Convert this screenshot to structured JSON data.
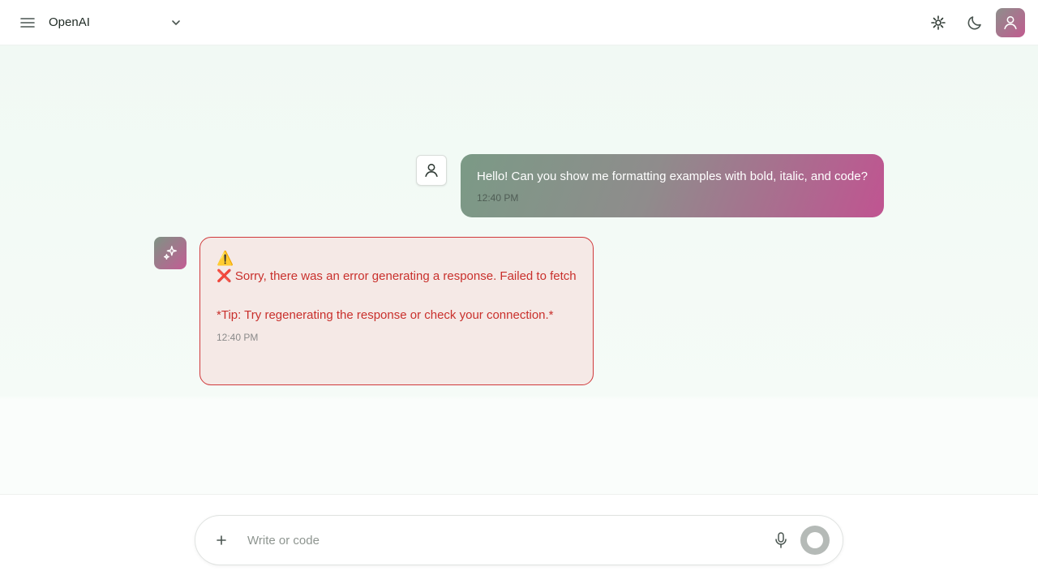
{
  "header": {
    "model_name": "OpenAI",
    "icons": {
      "menu": "hamburger-icon",
      "model_dropdown": "chevron-down-icon",
      "theme_light": "sun-icon",
      "theme_dark": "moon-icon",
      "profile": "user-icon"
    }
  },
  "messages": [
    {
      "role": "user",
      "text": "Hello! Can you show me formatting examples with bold, italic, and code?",
      "time": "12:40 PM"
    },
    {
      "role": "assistant",
      "status": "error",
      "warning_glyph": "⚠️",
      "error_text": "❌ Sorry, there was an error generating a response. Failed to fetch",
      "tip_text": "*Tip: Try regenerating the response or check your connection.*",
      "time": "12:40 PM"
    }
  ],
  "composer": {
    "placeholder": "Write or code",
    "value": "",
    "icons": {
      "attach": "plus-icon",
      "voice": "microphone-icon",
      "send": "send-icon"
    }
  },
  "colors": {
    "accent_pink": "#c05491",
    "accent_green": "#7b9a86",
    "error_red": "#c9302c",
    "error_bg": "#f5e9e6"
  }
}
